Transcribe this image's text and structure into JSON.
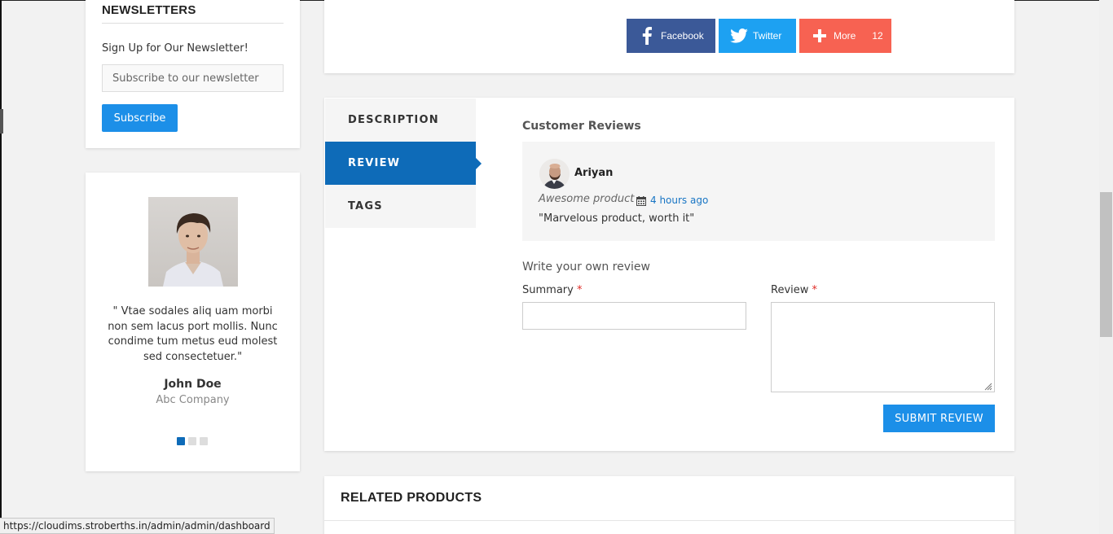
{
  "newsletter": {
    "title": "NEWSLETTERS",
    "signup_text": "Sign Up for Our Newsletter!",
    "email_placeholder": "Subscribe to our newsletter",
    "subscribe_label": "Subscribe"
  },
  "testimonial": {
    "quote": "\" Vtae sodales aliq uam morbi non sem lacus port mollis. Nunc condime tum metus eud molest sed consectetuer.\"",
    "name": "John Doe",
    "company": "Abc Company",
    "slide_count": 3,
    "active_slide": 1
  },
  "share": {
    "facebook_label": "Facebook",
    "twitter_label": "Twitter",
    "more_label": "More",
    "more_count": "12",
    "colors": {
      "facebook": "#3b5998",
      "twitter": "#1da1f2",
      "more": "#f76252"
    }
  },
  "tabs": {
    "items": [
      {
        "label": "DESCRIPTION"
      },
      {
        "label": "REVIEW"
      },
      {
        "label": "TAGS"
      }
    ],
    "active": "REVIEW"
  },
  "reviews": {
    "title": "Customer Reviews",
    "items": [
      {
        "author": "Ariyan",
        "summary": "Awesome product",
        "time": "4 hours ago",
        "text": "\"Marvelous product, worth it\""
      }
    ]
  },
  "review_form": {
    "title": "Write your own review",
    "summary_label": "Summary",
    "review_label": "Review",
    "required_mark": "*",
    "submit_label": "SUBMIT REVIEW"
  },
  "related": {
    "title": "RELATED PRODUCTS"
  },
  "status_url": "https://cloudims.stroberths.in/admin/admin/dashboard",
  "colors": {
    "primary": "#0e6bb8",
    "button": "#1c8fe8",
    "link": "#1875c4",
    "required": "#e02b27"
  }
}
